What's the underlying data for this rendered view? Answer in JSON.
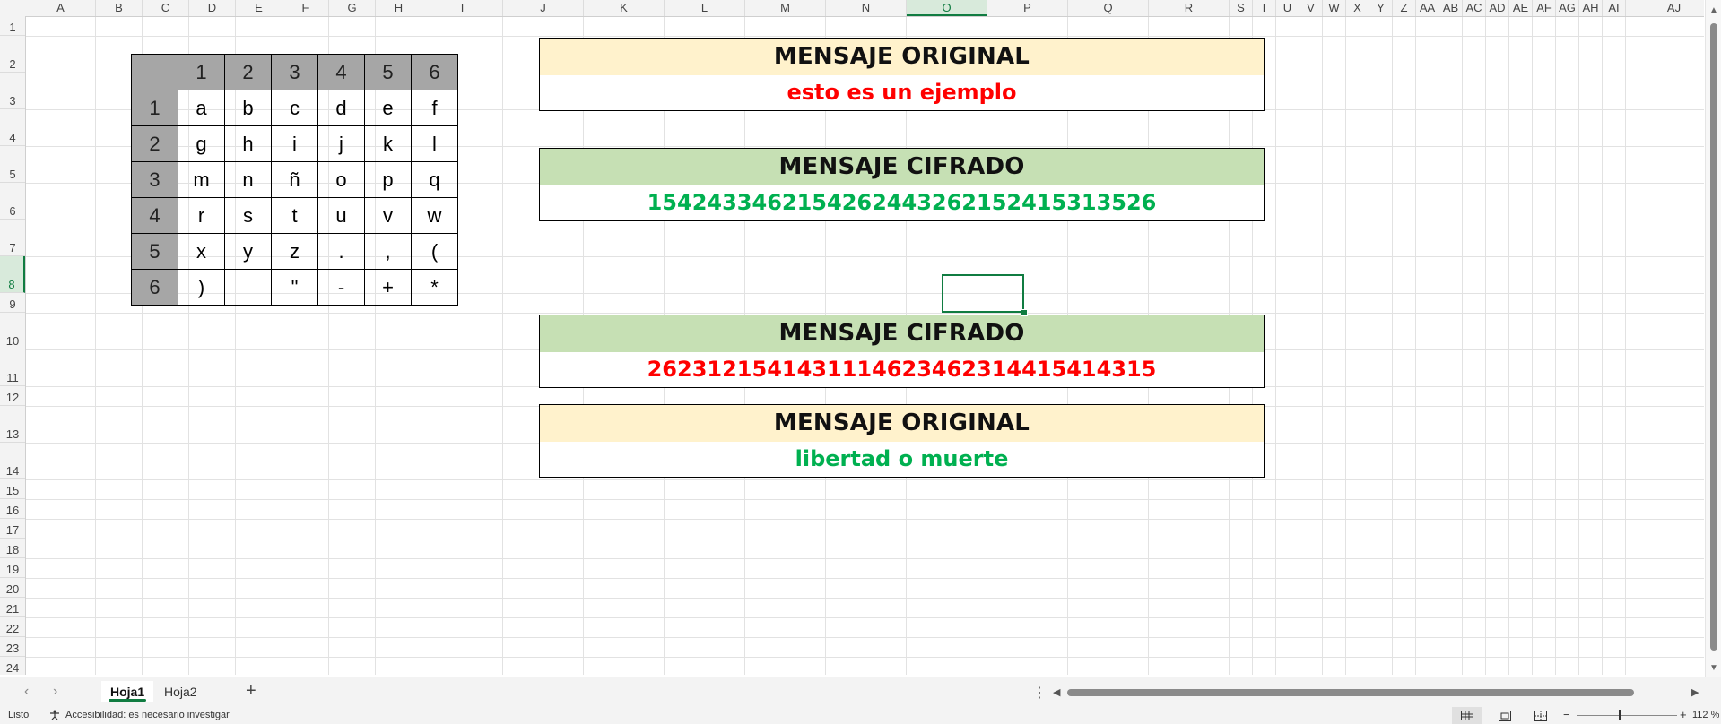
{
  "columns": [
    "A",
    "B",
    "C",
    "D",
    "E",
    "F",
    "G",
    "H",
    "I",
    "J",
    "K",
    "L",
    "M",
    "N",
    "O",
    "P",
    "Q",
    "R",
    "S",
    "T",
    "U",
    "V",
    "W",
    "X",
    "Y",
    "Z",
    "AA",
    "AB",
    "AC",
    "AD",
    "AE",
    "AF",
    "AG",
    "AH",
    "AI",
    "AJ"
  ],
  "rows": [
    "1",
    "2",
    "3",
    "4",
    "5",
    "6",
    "7",
    "8",
    "9",
    "10",
    "11",
    "12",
    "13",
    "14",
    "15",
    "16",
    "17",
    "18",
    "19",
    "20",
    "21",
    "22",
    "23",
    "24"
  ],
  "selected_cell": "O8",
  "polybius": {
    "header": [
      "",
      "1",
      "2",
      "3",
      "4",
      "5",
      "6"
    ],
    "body": [
      [
        "1",
        "a",
        "b",
        "c",
        "d",
        "e",
        "f"
      ],
      [
        "2",
        "g",
        "h",
        "i",
        "j",
        "k",
        "l"
      ],
      [
        "3",
        "m",
        "n",
        "ñ",
        "o",
        "p",
        "q"
      ],
      [
        "4",
        "r",
        "s",
        "t",
        "u",
        "v",
        "w"
      ],
      [
        "5",
        "x",
        "y",
        "z",
        ".",
        ",",
        "("
      ],
      [
        "6",
        ")",
        "",
        "\"",
        "-",
        "+",
        "*"
      ]
    ]
  },
  "messages": [
    {
      "title": "MENSAJE ORIGINAL",
      "value": "esto es un ejemplo",
      "title_bg": "#fff2cc",
      "value_color": "#ff0000"
    },
    {
      "title": "MENSAJE CIFRADO",
      "value": "1542433462154262443262152415313526",
      "title_bg": "#c6e0b4",
      "value_color": "#00b050"
    },
    {
      "title": "MENSAJE CIFRADO",
      "value": "2623121541431114623462314415414315",
      "title_bg": "#c6e0b4",
      "value_color": "#ff0000"
    },
    {
      "title": "MENSAJE ORIGINAL",
      "value": "libertad o muerte",
      "title_bg": "#fff2cc",
      "value_color": "#00b050"
    }
  ],
  "sheets": {
    "tabs": [
      "Hoja1",
      "Hoja2"
    ],
    "active": "Hoja1",
    "add_label": "+",
    "more_label": "⋮"
  },
  "status_bar": {
    "ready": "Listo",
    "accessibility": "Accesibilidad: es necesario investigar",
    "zoom": "112 %",
    "zoom_out": "−",
    "zoom_in": "+"
  },
  "colors": {
    "accent": "#107c41"
  }
}
